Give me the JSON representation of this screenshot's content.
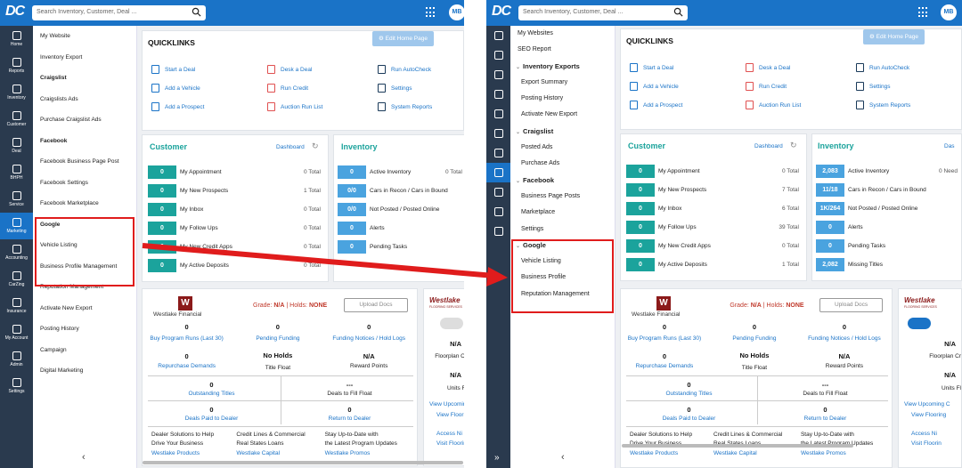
{
  "colors": {
    "brand_blue": "#1a73c7",
    "rail_dark": "#2a3a4e",
    "teal": "#1ba39c",
    "light_blue": "#4aa3df",
    "annotation_red": "#e01c1c"
  },
  "common": {
    "logo": "DC",
    "search_placeholder": "Search Inventory, Customer, Deal ...",
    "avatar_initials": "MB",
    "quicklinks_title": "QUICKLINKS",
    "edit_home_page": "Edit Home Page",
    "quicklinks": [
      {
        "label": "Start a Deal",
        "icon": "clipboard-icon"
      },
      {
        "label": "Desk a Deal",
        "icon": "document-icon"
      },
      {
        "label": "Run AutoCheck",
        "icon": "checkbox-icon"
      },
      {
        "label": "Add a Vehicle",
        "icon": "car-icon"
      },
      {
        "label": "Run Credit",
        "icon": "report-icon"
      },
      {
        "label": "Settings",
        "icon": "gear-icon"
      },
      {
        "label": "Add a Prospect",
        "icon": "person-icon"
      },
      {
        "label": "Auction Run List",
        "icon": "truck-icon"
      },
      {
        "label": "System Reports",
        "icon": "document-icon"
      }
    ],
    "customer_title": "Customer",
    "dashboard_link": "Dashboard",
    "inventory_title": "Inventory",
    "customer_labels": [
      "My Appointment",
      "My New Prospects",
      "My Inbox",
      "My Follow Ups",
      "My New Credit Apps",
      "My Active Deposits"
    ],
    "westlake": {
      "name": "Westlake Financial",
      "grade_label": "Grade:",
      "grade_value": "N/A",
      "holds_label": "| Holds:",
      "holds_value": "NONE",
      "upload_docs": "Upload Docs",
      "buy_program_runs": "Buy Program Runs (Last 30)",
      "pending_funding": "Pending Funding",
      "funding_notices": "Funding Notices / Hold Logs",
      "repurchase_demands": "Repurchase Demands",
      "no_holds": "No Holds",
      "title_float": "Title Float",
      "reward_points": "Reward Points",
      "outstanding_titles": "Outstanding Titles",
      "deals_to_fill": "Deals to Fill Float",
      "deals_paid": "Deals Paid to Dealer",
      "return_to_dealer": "Return to Dealer",
      "zero": "0",
      "na": "N/A",
      "dashes": "---",
      "promo1a": "Dealer Solutions to Help",
      "promo1b": "Drive Your Business",
      "promo2a": "Credit Lines & Commercial",
      "promo2b": "Real States Loans",
      "promo3a": "Stay Up-to-Date with",
      "promo3b": "the Latest Program Updates",
      "westlake_products": "Westlake Products",
      "westlake_capital": "Westlake Capital",
      "westlake_promos": "Westlake Promos"
    },
    "flooring": {
      "logo": "Westlake",
      "logo_sub": "FLOORING SERVICES",
      "na": "N/A",
      "floorplan": "Floorplan Cr",
      "units": "Units Fl",
      "view_upcoming": "View Upcoming C",
      "view_flooring": "View Flooring",
      "access": "Access Ni",
      "visit": "Visit Floorin"
    }
  },
  "left": {
    "rail": [
      "Home",
      "Reports",
      "Inventory",
      "Customer",
      "Deal",
      "BHPH",
      "Service",
      "Marketing",
      "Accounting",
      "CarZing",
      "Insurance",
      "My Account",
      "Admin",
      "Settings"
    ],
    "rail_active": "Marketing",
    "subnav": [
      {
        "label": "My Website",
        "h": false
      },
      {
        "label": "Inventory Export",
        "h": false
      },
      {
        "label": "Craigslist",
        "h": true
      },
      {
        "label": "Craigslists Ads",
        "h": false
      },
      {
        "label": "Purchase Craigslist Ads",
        "h": false
      },
      {
        "label": "Facebook",
        "h": true
      },
      {
        "label": "Facebook Business Page Post",
        "h": false
      },
      {
        "label": "Facebook Settings",
        "h": false
      },
      {
        "label": "Facebook Marketplace",
        "h": false
      },
      {
        "label": "Google",
        "h": true
      },
      {
        "label": "Vehicle Listing",
        "h": false
      },
      {
        "label": "Business Profile Management",
        "h": false
      },
      {
        "label": "Reputation Management",
        "h": false
      },
      {
        "label": "Activate New Export",
        "h": false
      },
      {
        "label": "Posting History",
        "h": false
      },
      {
        "label": "Campaign",
        "h": false
      },
      {
        "label": "Digital Marketing",
        "h": false
      }
    ],
    "customer_badges": [
      "0",
      "0",
      "0",
      "0",
      "0",
      "0"
    ],
    "customer_totals": [
      "0 Total",
      "1 Total",
      "0 Total",
      "0 Total",
      "0 Total",
      "0 Total"
    ],
    "inventory_rows": [
      {
        "badge": "0",
        "label": "Active Inventory",
        "total": "0 Total"
      },
      {
        "badge": "0/0",
        "label": "Cars in Recon / Cars in Bound",
        "total": ""
      },
      {
        "badge": "0/0",
        "label": "Not Posted / Posted Online",
        "total": ""
      },
      {
        "badge": "0",
        "label": "Alerts",
        "total": ""
      },
      {
        "badge": "0",
        "label": "Pending Tasks",
        "total": ""
      }
    ]
  },
  "right": {
    "subnav": [
      {
        "label": "My Websites",
        "h": false,
        "top": true
      },
      {
        "label": "SEO Report",
        "h": false,
        "top": true
      },
      {
        "label": "Inventory Exports",
        "h": true
      },
      {
        "label": "Export Summary",
        "h": false
      },
      {
        "label": "Posting History",
        "h": false
      },
      {
        "label": "Activate New Export",
        "h": false
      },
      {
        "label": "Craigslist",
        "h": true
      },
      {
        "label": "Posted Ads",
        "h": false
      },
      {
        "label": "Purchase Ads",
        "h": false
      },
      {
        "label": "Facebook",
        "h": true
      },
      {
        "label": "Business Page Posts",
        "h": false
      },
      {
        "label": "Marketplace",
        "h": false
      },
      {
        "label": "Settings",
        "h": false
      },
      {
        "label": "Google",
        "h": true
      },
      {
        "label": "Vehicle Listing",
        "h": false
      },
      {
        "label": "Business Profile",
        "h": false
      },
      {
        "label": "Reputation Management",
        "h": false
      }
    ],
    "customer_badges": [
      "0",
      "0",
      "0",
      "0",
      "0",
      "0"
    ],
    "customer_totals": [
      "0 Total",
      "7 Total",
      "6 Total",
      "39 Total",
      "0 Total",
      "1 Total"
    ],
    "inventory_rows": [
      {
        "badge": "2,083",
        "label": "Active Inventory",
        "total": "0 Need"
      },
      {
        "badge": "11/18",
        "label": "Cars in Recon / Cars in Bound",
        "total": ""
      },
      {
        "badge": "1K/264",
        "label": "Not Posted / Posted Online",
        "total": ""
      },
      {
        "badge": "0",
        "label": "Alerts",
        "total": ""
      },
      {
        "badge": "0",
        "label": "Pending Tasks",
        "total": ""
      },
      {
        "badge": "2,082",
        "label": "Missing Titles",
        "total": ""
      }
    ],
    "inventory_title_cut": "Das"
  }
}
